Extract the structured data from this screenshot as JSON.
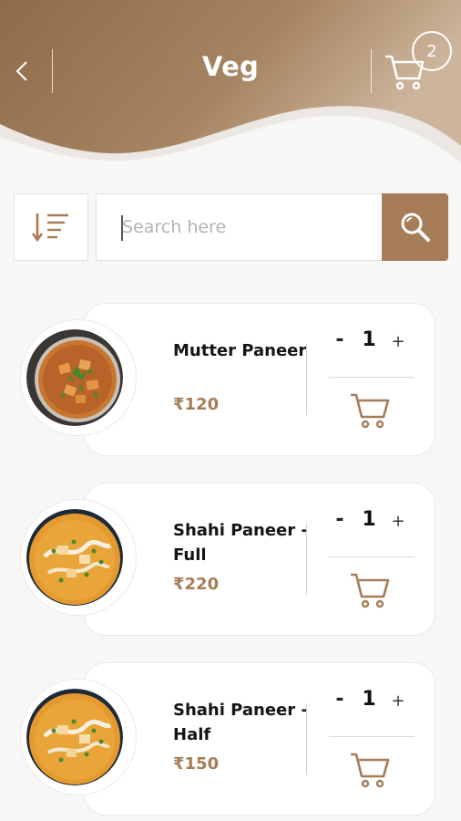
{
  "header": {
    "title": "Veg",
    "back_icon": "chevron-left-icon",
    "cart_icon": "cart-icon",
    "cart_count": "2"
  },
  "toolbar": {
    "sort_icon": "sort-descending-icon",
    "search_placeholder": "Search here",
    "search_value": "",
    "search_icon": "search-icon"
  },
  "items": [
    {
      "name": "Mutter Paneer",
      "price": "₹120",
      "quantity": "1",
      "minus": "-",
      "plus": "+",
      "add_icon": "add-to-cart-icon"
    },
    {
      "name": "Shahi Paneer - Full",
      "price": "₹220",
      "quantity": "1",
      "minus": "-",
      "plus": "+",
      "add_icon": "add-to-cart-icon"
    },
    {
      "name": "Shahi Paneer - Half",
      "price": "₹150",
      "quantity": "1",
      "minus": "-",
      "plus": "+",
      "add_icon": "add-to-cart-icon"
    }
  ],
  "colors": {
    "brand": "#a67d58",
    "header_dark": "#8a6a48",
    "header_light": "#c7a98c",
    "background": "#f7f7f6",
    "text": "#141414"
  }
}
